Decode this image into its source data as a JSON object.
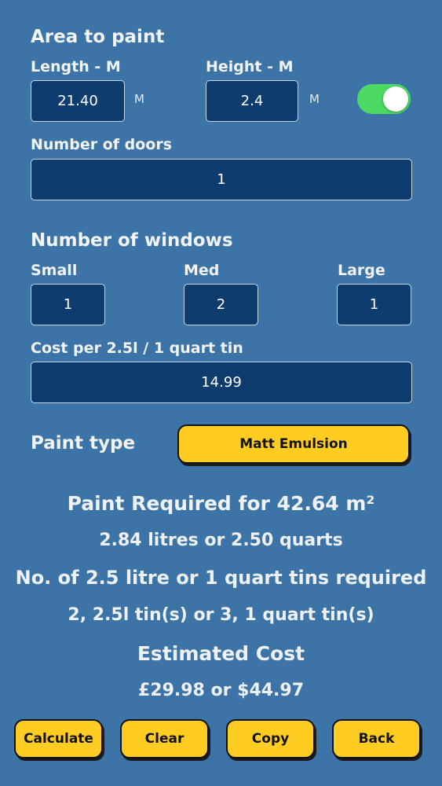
{
  "area": {
    "heading": "Area to paint",
    "length_label": "Length - M",
    "length_value": "21.40",
    "length_unit": "M",
    "height_label": "Height - M",
    "height_value": "2.4",
    "height_unit": "M",
    "unit_toggle_on": true
  },
  "doors": {
    "label": "Number of doors",
    "value": "1"
  },
  "windows": {
    "heading": "Number of windows",
    "small_label": "Small",
    "small_value": "1",
    "med_label": "Med",
    "med_value": "2",
    "large_label": "Large",
    "large_value": "1"
  },
  "cost": {
    "label": "Cost per 2.5l / 1 quart tin",
    "value": "14.99"
  },
  "paint": {
    "label": "Paint type",
    "selected": "Matt Emulsion"
  },
  "results": {
    "required_title": "Paint Required for 42.64 m²",
    "volume": "2.84 litres or 2.50 quarts",
    "tins_title": "No. of 2.5 litre or 1 quart tins required",
    "tins": "2, 2.5l tin(s) or 3, 1 quart tin(s)",
    "cost_title": "Estimated Cost",
    "cost": "£29.98 or $44.97"
  },
  "buttons": {
    "calculate": "Calculate",
    "clear": "Clear",
    "copy": "Copy",
    "back": "Back"
  },
  "colors": {
    "background": "#3d74a8",
    "field": "#0f3c6e",
    "button": "#ffcc22",
    "toggle_on": "#4cd964"
  }
}
